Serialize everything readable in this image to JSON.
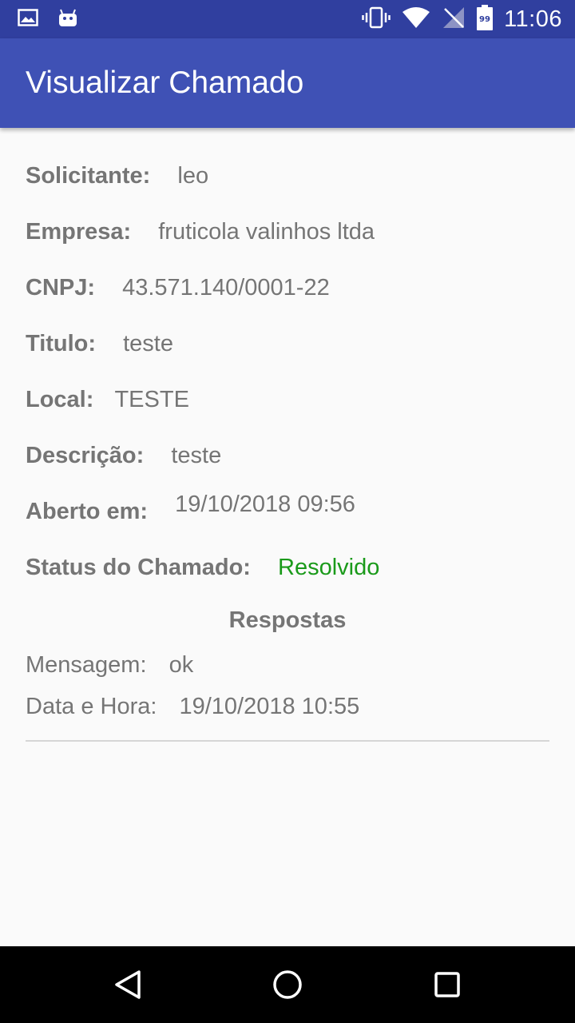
{
  "status_bar": {
    "time": "11:06",
    "left_icons": [
      "image-notification-icon",
      "android-notification-icon"
    ],
    "right_icons": [
      "vibrate-icon",
      "wifi-icon",
      "no-signal-icon",
      "battery-icon"
    ],
    "battery_level": "99"
  },
  "app_bar": {
    "title": "Visualizar Chamado"
  },
  "details": {
    "solicitante_label": "Solicitante:",
    "solicitante_value": "leo",
    "empresa_label": "Empresa:",
    "empresa_value": "fruticola valinhos ltda",
    "cnpj_label": "CNPJ:",
    "cnpj_value": "43.571.140/0001-22",
    "titulo_label": "Titulo:",
    "titulo_value": "teste",
    "local_label": "Local:",
    "local_value": "TESTE",
    "descricao_label": "Descrição:",
    "descricao_value": "teste",
    "aberto_label": "Aberto em:",
    "aberto_value": "19/10/2018 09:56",
    "status_label": "Status do Chamado:",
    "status_value": "Resolvido",
    "status_color": "#1a9a1a"
  },
  "respostas": {
    "title": "Respostas",
    "mensagem_label": "Mensagem:",
    "mensagem_value": "ok",
    "datahora_label": "Data e Hora:",
    "datahora_value": "19/10/2018 10:55"
  },
  "nav_bar": {
    "buttons": [
      "back-icon",
      "home-icon",
      "recents-icon"
    ]
  },
  "colors": {
    "status_bar": "#303f9f",
    "app_bar": "#3f51b5",
    "background": "#fafafa",
    "text": "#757575"
  }
}
